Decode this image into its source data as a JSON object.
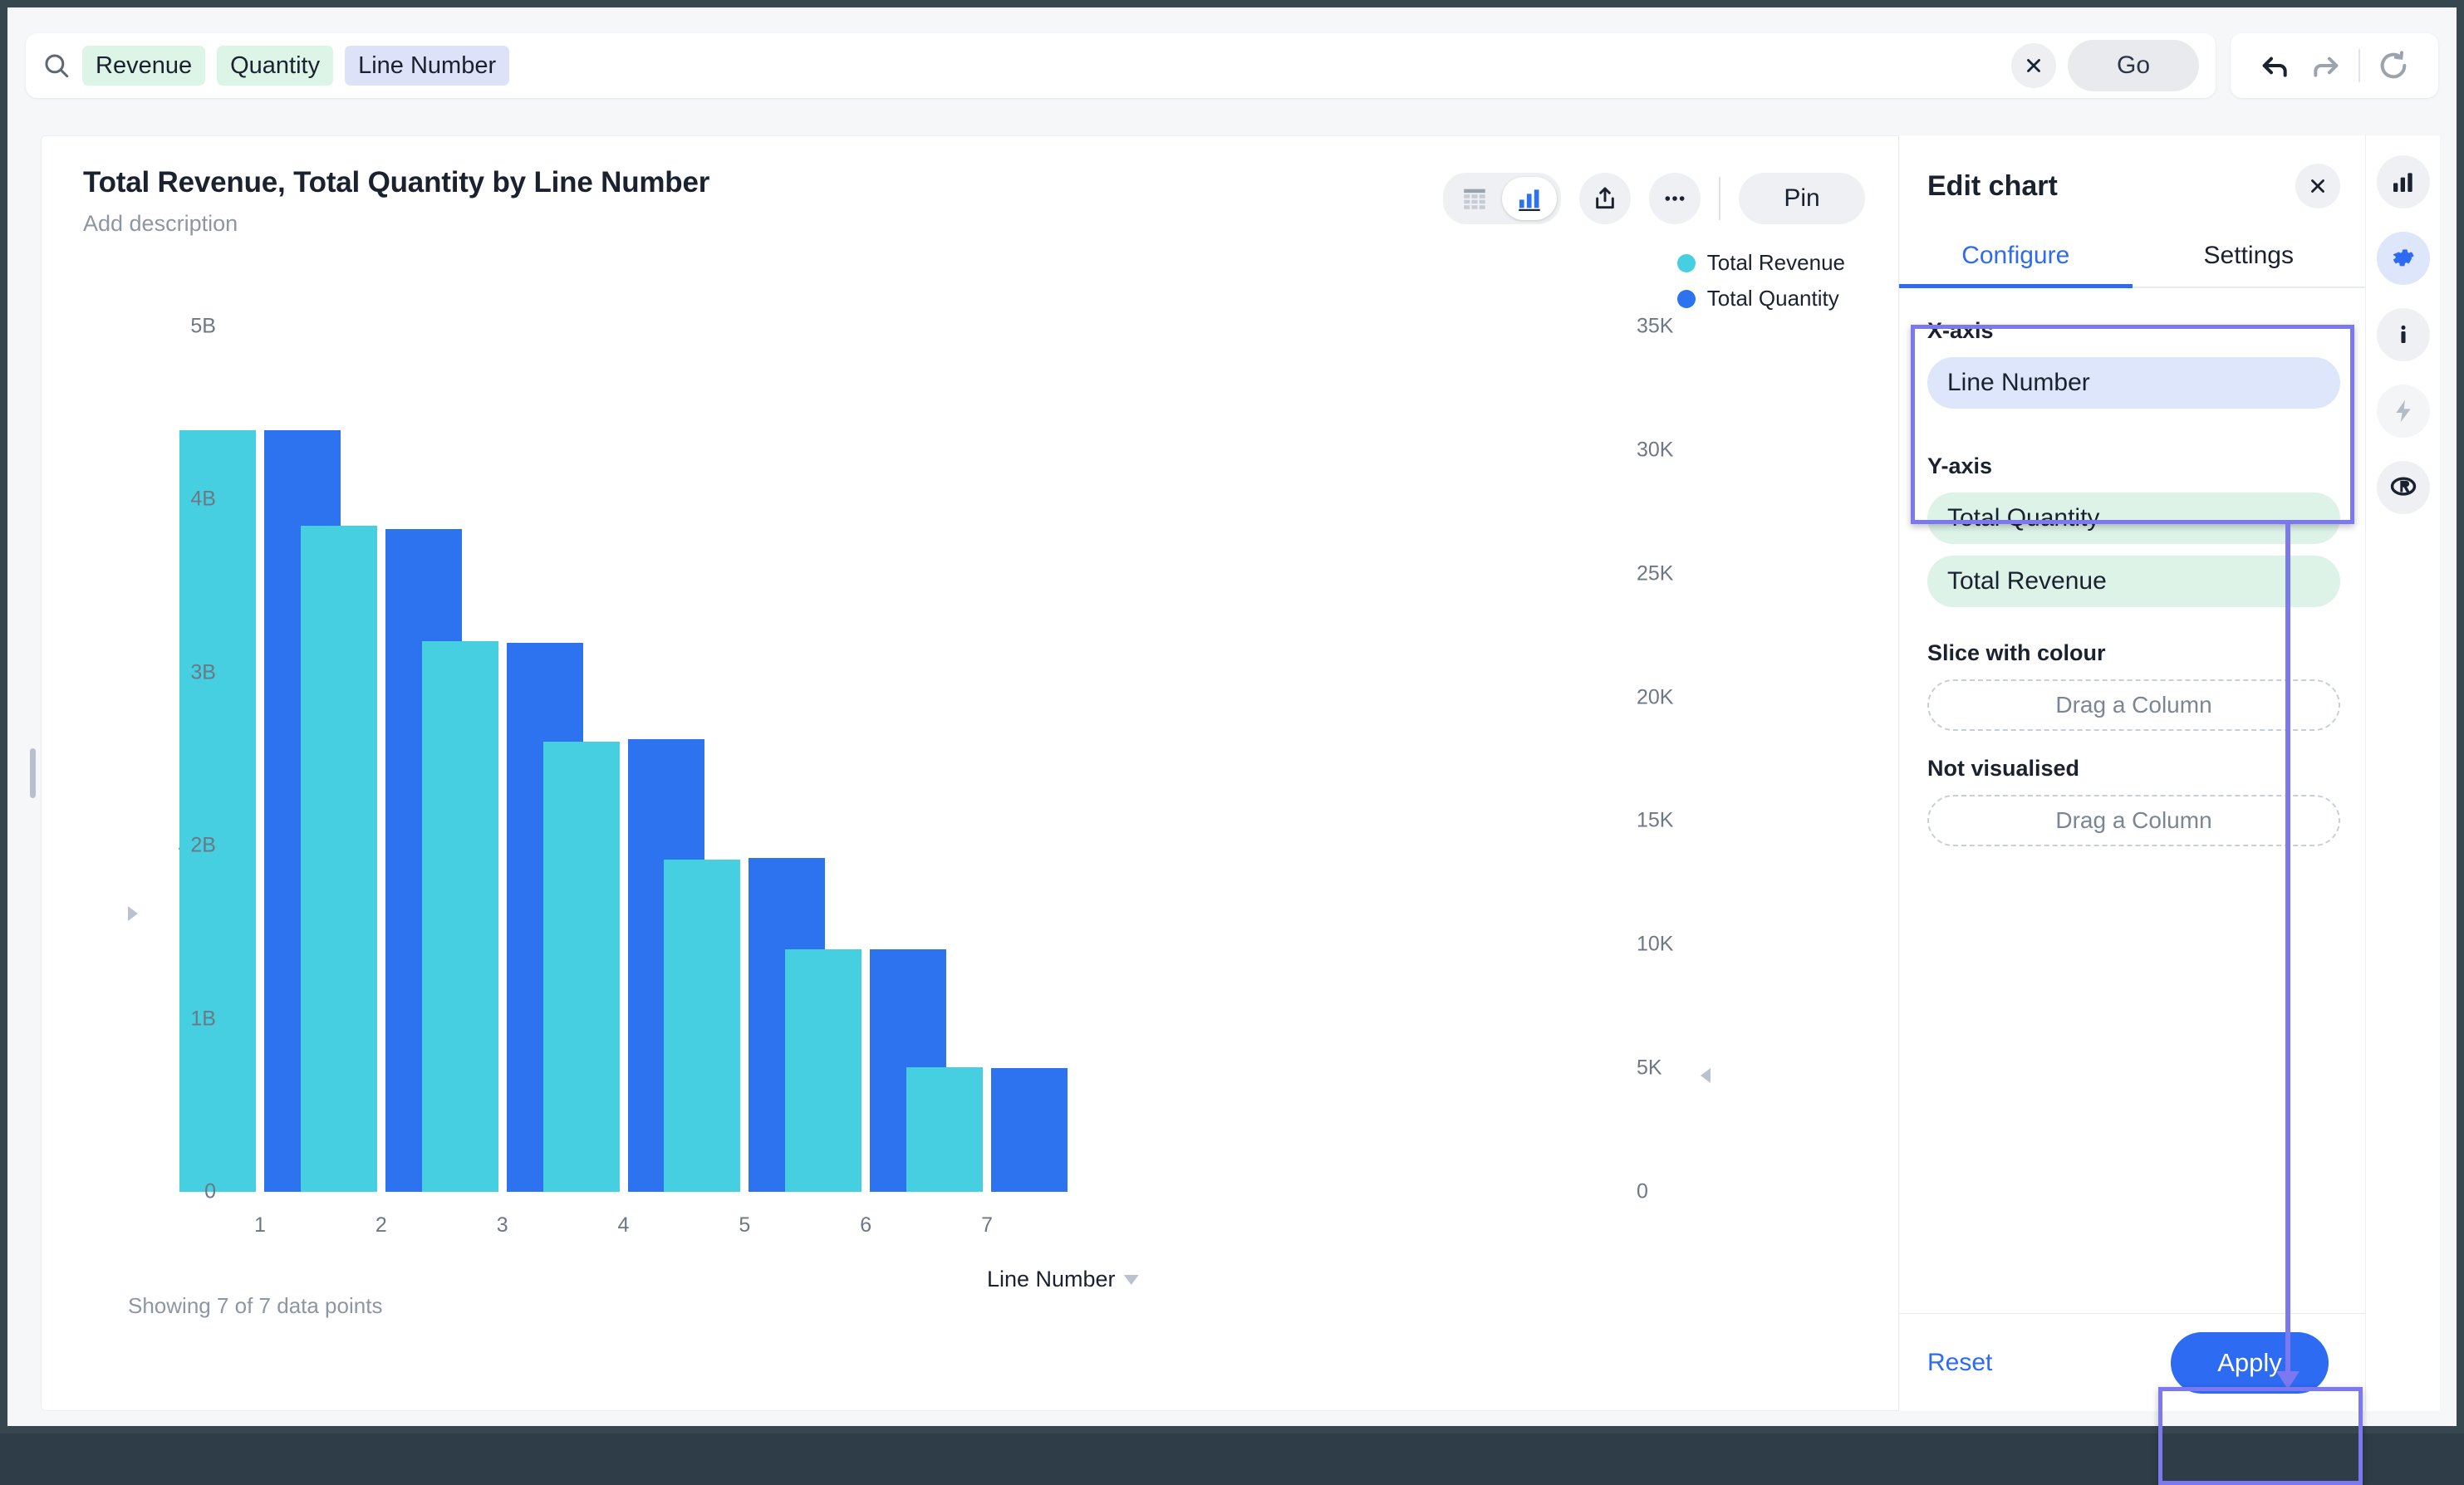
{
  "search": {
    "icon": "search-icon",
    "chips": [
      {
        "label": "Revenue",
        "tone": "green"
      },
      {
        "label": "Quantity",
        "tone": "green"
      },
      {
        "label": "Line Number",
        "tone": "blue"
      }
    ],
    "clear_label": "×",
    "go_label": "Go"
  },
  "history": {
    "undo": "undo-icon",
    "redo": "redo-icon",
    "reset": "reset-icon"
  },
  "chart_header": {
    "title": "Total Revenue, Total Quantity by Line Number",
    "description_placeholder": "Add description",
    "view_table": "table-view-icon",
    "view_chart": "chart-view-icon",
    "share": "share-icon",
    "more": "more-icon",
    "pin_label": "Pin"
  },
  "footer": {
    "datapoints": "Showing 7 of 7 data points"
  },
  "panel": {
    "title": "Edit chart",
    "close": "close-icon",
    "tabs": [
      {
        "label": "Configure",
        "active": true
      },
      {
        "label": "Settings",
        "active": false
      }
    ],
    "x_axis_label": "X-axis",
    "x_axis_value": "Line Number",
    "y_axis_label": "Y-axis",
    "y_axis_values": [
      "Total Quantity",
      "Total Revenue"
    ],
    "slice_label": "Slice with colour",
    "slice_placeholder": "Drag a Column",
    "not_visualised_label": "Not visualised",
    "not_visualised_placeholder": "Drag a Column",
    "reset_label": "Reset",
    "apply_label": "Apply"
  },
  "rail": {
    "items": [
      {
        "icon": "chart-icon",
        "state": "normal"
      },
      {
        "icon": "gear-icon",
        "state": "active"
      },
      {
        "icon": "info-icon",
        "state": "normal"
      },
      {
        "icon": "lightning-icon",
        "state": "dim"
      },
      {
        "icon": "r-logo-icon",
        "state": "normal"
      }
    ]
  },
  "colors": {
    "revenue": "#45cfe0",
    "quantity": "#2d72ee",
    "accent": "#2d6bf2",
    "annotation": "#7b78f0"
  },
  "chart_data": {
    "type": "bar",
    "title": "Total Revenue, Total Quantity by Line Number",
    "xlabel": "Line Number",
    "categories": [
      "1",
      "2",
      "3",
      "4",
      "5",
      "6",
      "7"
    ],
    "grid": false,
    "legend_position": "top-right",
    "series": [
      {
        "name": "Total Revenue",
        "axis": "left",
        "color": "#45cfe0",
        "ylabel": "Total Revenue",
        "ylim": [
          0,
          5000000000
        ],
        "yticks": [
          "0",
          "1B",
          "2B",
          "3B",
          "4B",
          "5B"
        ],
        "ytick_values": [
          0,
          1000000000,
          2000000000,
          3000000000,
          4000000000,
          5000000000
        ],
        "values": [
          4400000000,
          3850000000,
          3180000000,
          2600000000,
          1920000000,
          1400000000,
          720000000
        ]
      },
      {
        "name": "Total Quantity",
        "axis": "right",
        "color": "#2d72ee",
        "ylabel": "Total Quantity",
        "ylim": [
          0,
          35000
        ],
        "yticks": [
          "0",
          "5K",
          "10K",
          "15K",
          "20K",
          "25K",
          "30K",
          "35K"
        ],
        "ytick_values": [
          0,
          5000,
          10000,
          15000,
          20000,
          25000,
          30000,
          35000
        ],
        "values": [
          30800,
          26800,
          22200,
          18300,
          13500,
          9800,
          5000
        ]
      }
    ],
    "legend": [
      "Total Revenue",
      "Total Quantity"
    ]
  }
}
